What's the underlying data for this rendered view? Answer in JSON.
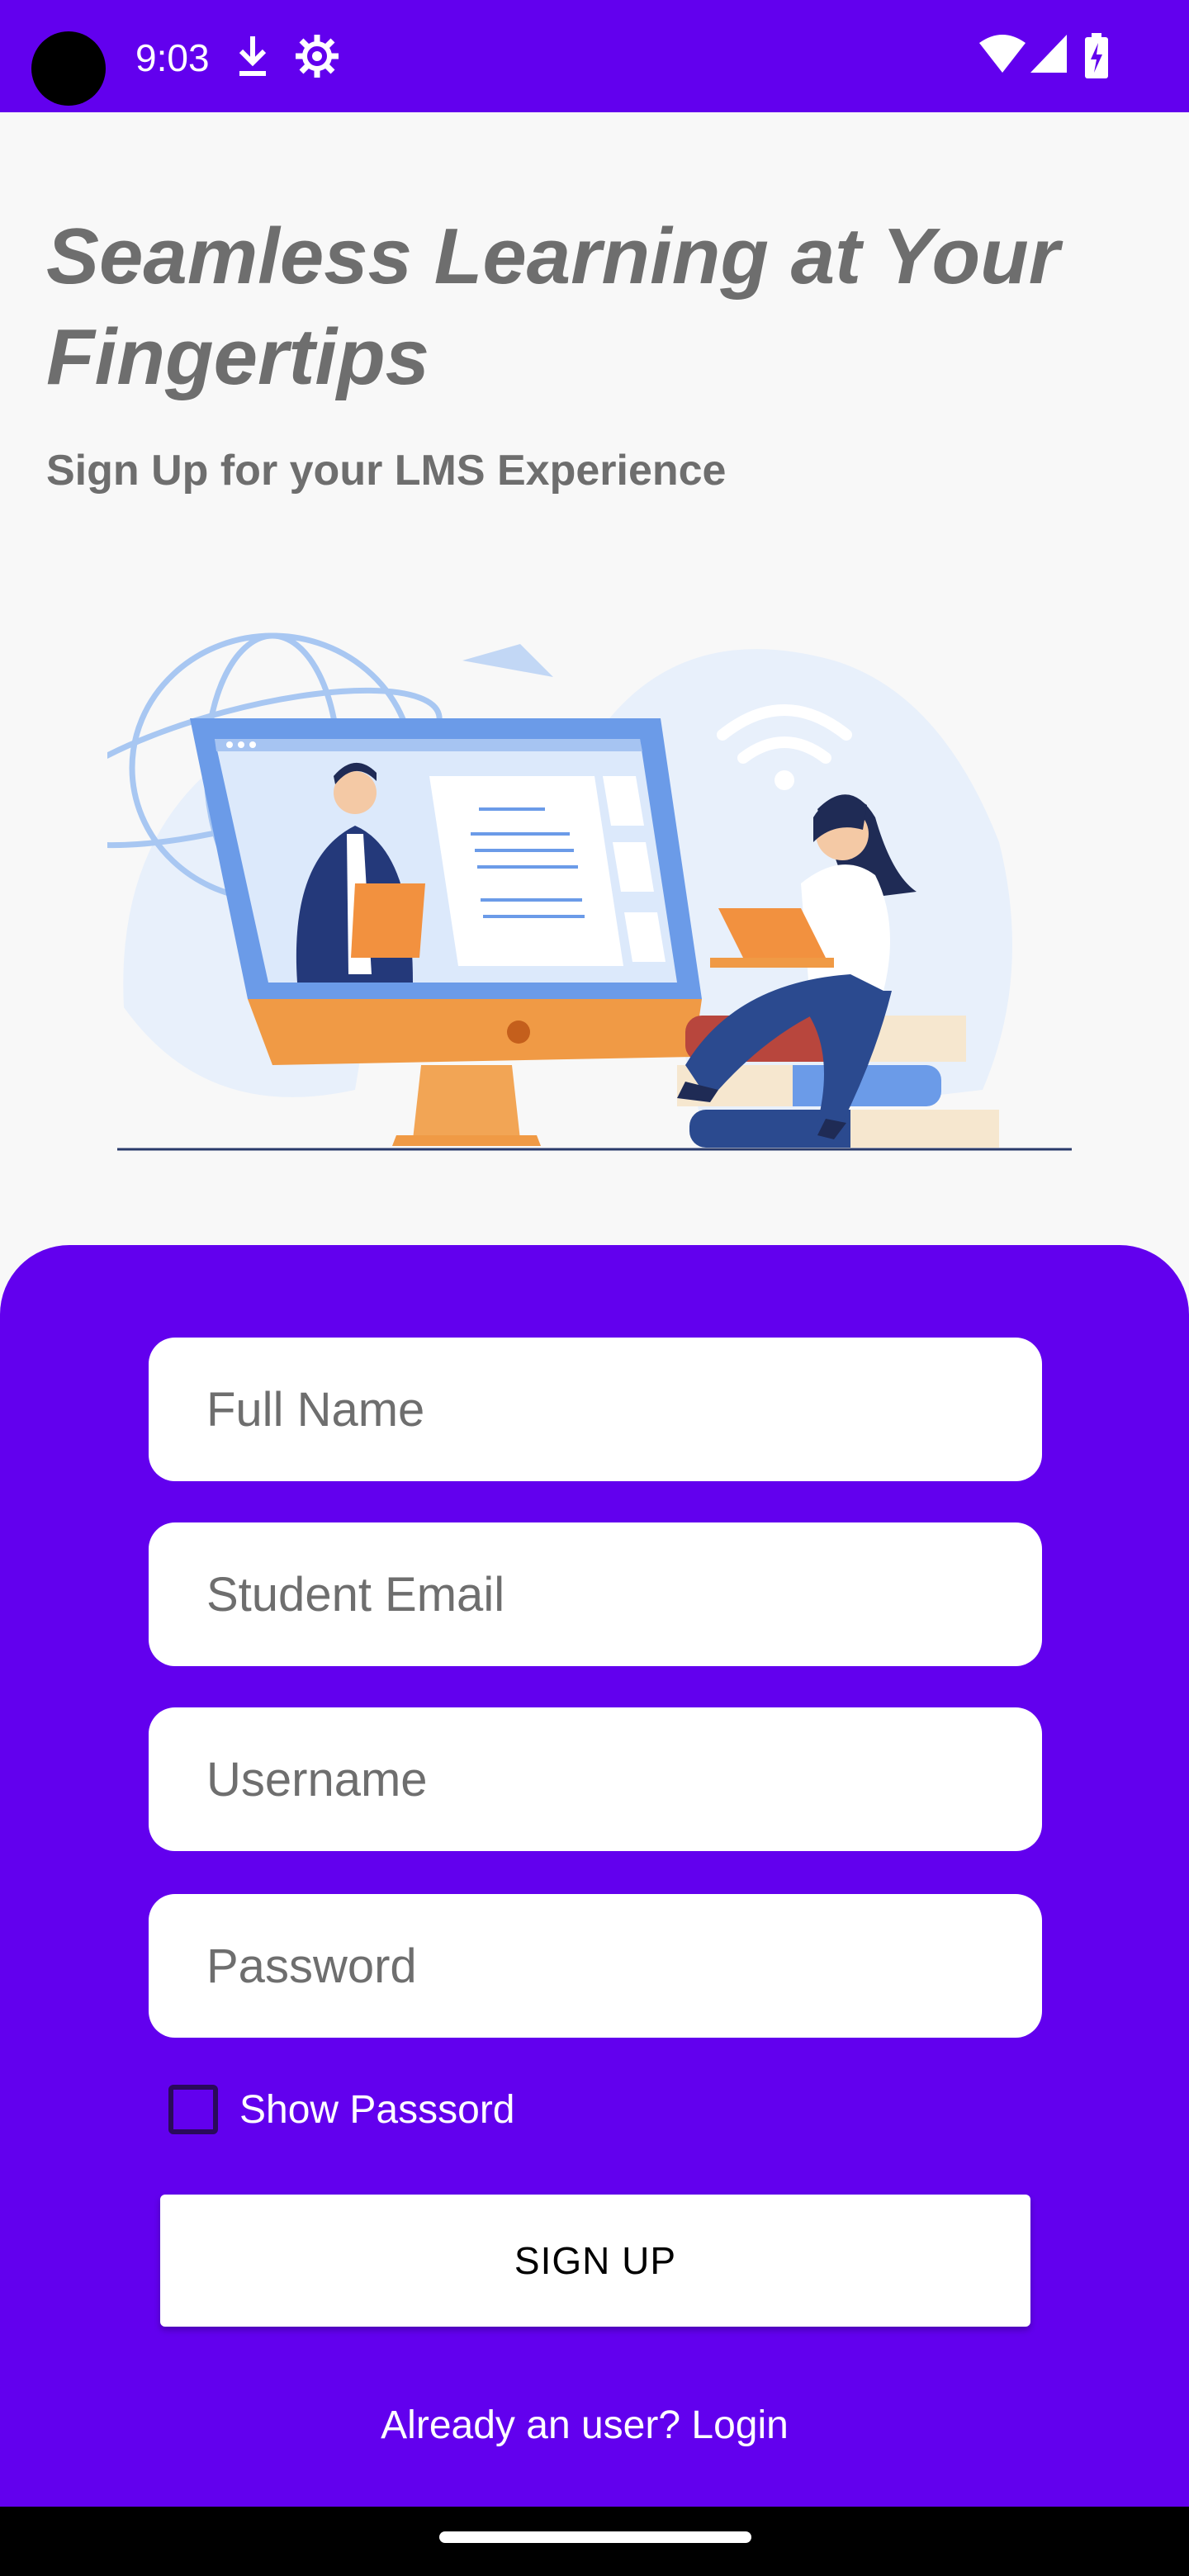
{
  "status_bar": {
    "time": "9:03",
    "icons_left": [
      "download-icon",
      "settings-gear-icon"
    ],
    "icons_right": [
      "wifi-icon",
      "signal-icon",
      "battery-icon"
    ]
  },
  "hero": {
    "title": "Seamless Learning at Your Fingertips",
    "subtitle": "Sign Up for your LMS Experience"
  },
  "form": {
    "full_name_placeholder": "Full Name",
    "email_placeholder": "Student Email",
    "username_placeholder": "Username",
    "password_placeholder": "Password",
    "show_password_label": "Show Passsord",
    "show_password_checked": false,
    "signup_label": "SIGN UP",
    "login_link": "Already an user? Login"
  },
  "colors": {
    "primary": "#6200ee",
    "heading": "#6e6e6e",
    "field_bg": "#ffffff"
  }
}
